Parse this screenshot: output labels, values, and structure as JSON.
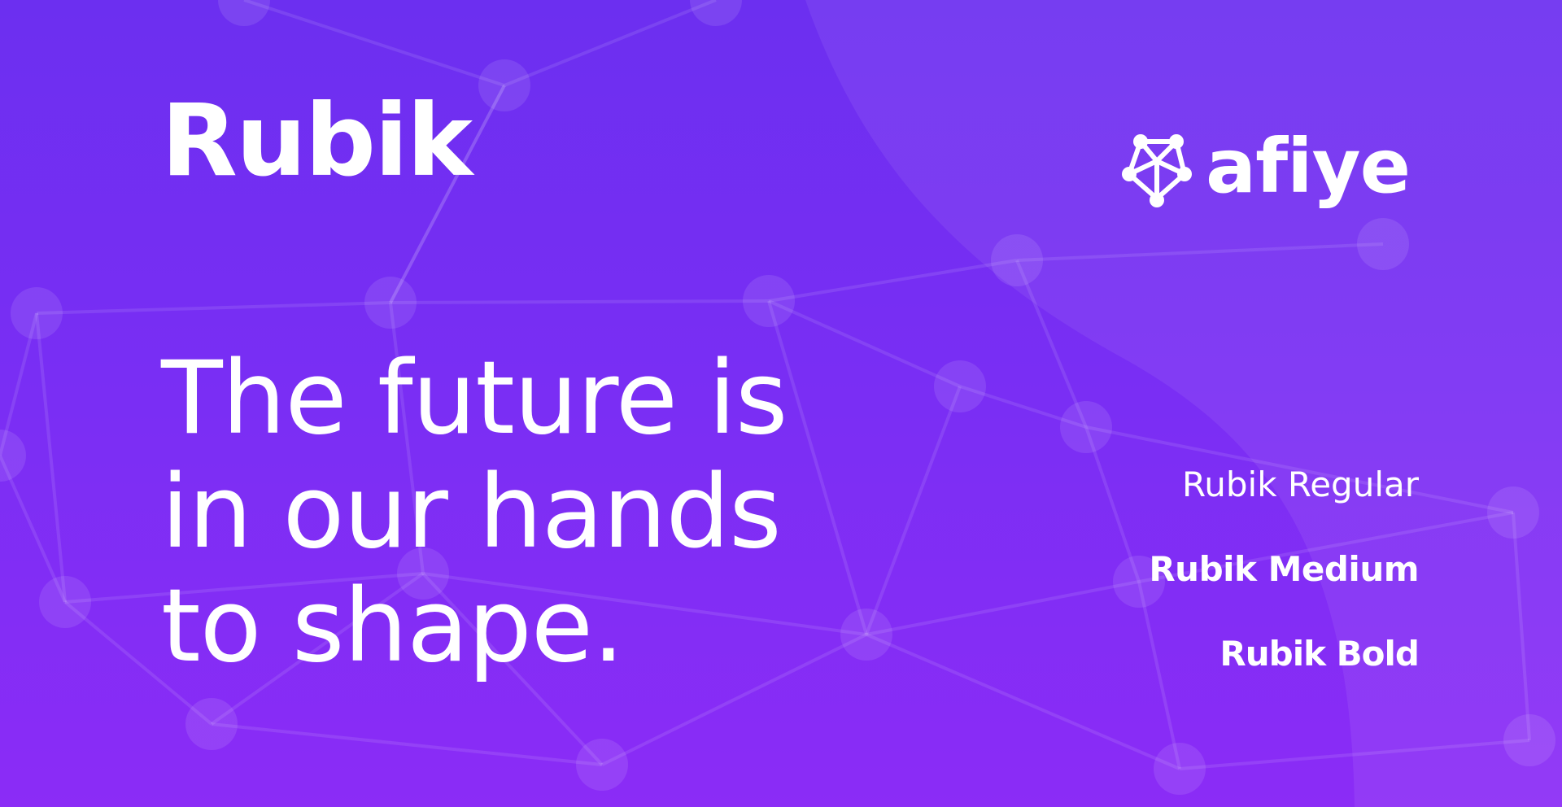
{
  "font_name": "Rubik",
  "brand": {
    "name": "afiye",
    "icon": "network-node-icon"
  },
  "tagline": {
    "lines": [
      "The future is",
      "in our hands",
      "to shape."
    ]
  },
  "weights": [
    "Rubik Regular",
    "Rubik Medium",
    "Rubik Bold"
  ],
  "colors": {
    "background_top": "#6c2ff0",
    "background_bottom": "#8b2cf6",
    "text": "#ffffff"
  }
}
